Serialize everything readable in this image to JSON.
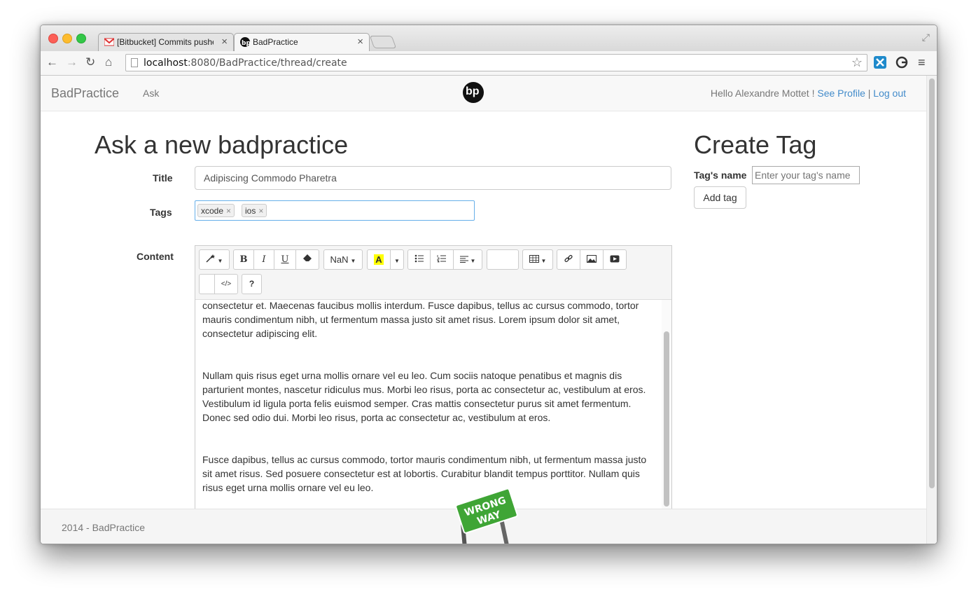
{
  "browser": {
    "tabs": [
      {
        "title": "[Bitbucket] Commits pushe",
        "icon": "gmail-icon"
      },
      {
        "title": "BadPractice",
        "icon": "bp-logo-icon"
      }
    ],
    "url_host": "localhost",
    "url_rest": ":8080/BadPractice/thread/create"
  },
  "navbar": {
    "brand": "BadPractice",
    "ask": "Ask",
    "logo_text": "bp",
    "greeting": "Hello Alexandre Mottet ! ",
    "see_profile": "See Profile",
    "separator": "|",
    "logout": "Log out"
  },
  "form": {
    "heading": "Ask a new badpractice",
    "title_label": "Title",
    "title_value": "Adipiscing Commodo Pharetra",
    "tags_label": "Tags",
    "tags": [
      "xcode",
      "ios"
    ],
    "tag_remove": "×",
    "content_label": "Content"
  },
  "editor": {
    "toolbar": {
      "font_size": "NaN",
      "bold": "B",
      "italic": "I",
      "underline": "U",
      "help": "?",
      "code": "</>",
      "text_height": "TI",
      "highlight": "A"
    },
    "paragraphs": [
      "consectetur et. Maecenas faucibus mollis interdum. Fusce dapibus, tellus ac cursus commodo, tortor mauris condimentum nibh, ut fermentum massa justo sit amet risus. Lorem ipsum dolor sit amet, consectetur adipiscing elit.",
      "Nullam quis risus eget urna mollis ornare vel eu leo. Cum sociis natoque penatibus et magnis dis parturient montes, nascetur ridiculus mus. Morbi leo risus, porta ac consectetur ac, vestibulum at eros. Vestibulum id ligula porta felis euismod semper. Cras mattis consectetur purus sit amet fermentum. Donec sed odio dui. Morbi leo risus, porta ac consectetur ac, vestibulum at eros.",
      "Fusce dapibus, tellus ac cursus commodo, tortor mauris condimentum nibh, ut fermentum massa justo sit amet risus. Sed posuere consectetur est at lobortis. Curabitur blandit tempus porttitor. Nullam quis risus eget urna mollis ornare vel eu leo."
    ]
  },
  "create_tag": {
    "heading": "Create Tag",
    "name_label": "Tag's name",
    "name_placeholder": "Enter your tag's name",
    "add_button": "Add tag"
  },
  "footer": {
    "text": "2014 - BadPractice",
    "sign_text_1": "WRONG",
    "sign_text_2": "WAY"
  },
  "colors": {
    "link": "#428bca",
    "highlight_yellow": "#ffff00",
    "sign_green": "#3fa535"
  }
}
